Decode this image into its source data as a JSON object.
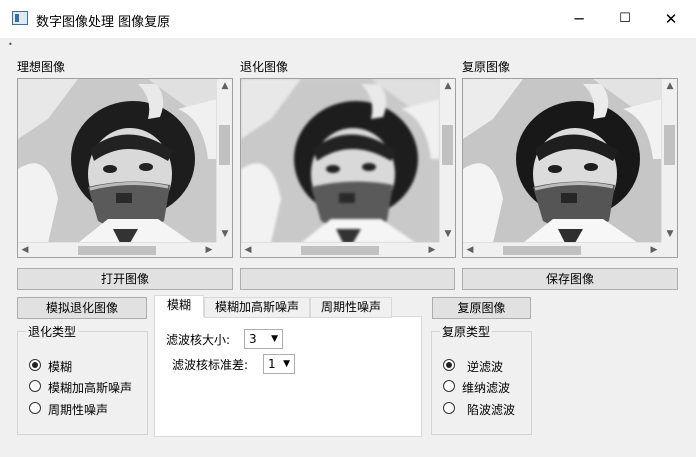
{
  "window": {
    "title": "数字图像处理 图像复原",
    "minimize_glyph": "─",
    "maximize_glyph": "☐",
    "close_glyph": "✕"
  },
  "panels": {
    "ideal_label": "理想图像",
    "degraded_label": "退化图像",
    "restored_label": "复原图像"
  },
  "buttons": {
    "open_image": "打开图像",
    "middle_blank": "",
    "save_image": "保存图像",
    "simulate_degrade": "模拟退化图像",
    "restore_image": "复原图像"
  },
  "degrade_group": {
    "title": "退化类型",
    "options": [
      "模糊",
      "模糊加高斯噪声",
      "周期性噪声"
    ],
    "selected": 0
  },
  "tabs": {
    "items": [
      "模糊",
      "模糊加高斯噪声",
      "周期性噪声"
    ],
    "active": 0,
    "kernel_size_label": "滤波核大小:",
    "kernel_size_value": "3",
    "kernel_std_label": "滤波核标准差:",
    "kernel_std_value": "1"
  },
  "restore_group": {
    "title": "复原类型",
    "options": [
      "逆滤波",
      "维纳滤波",
      "陷波滤波"
    ],
    "selected": 0
  },
  "icons": {
    "up": "▲",
    "down": "▼",
    "left": "◀",
    "right": "▶",
    "combo": "▼"
  }
}
